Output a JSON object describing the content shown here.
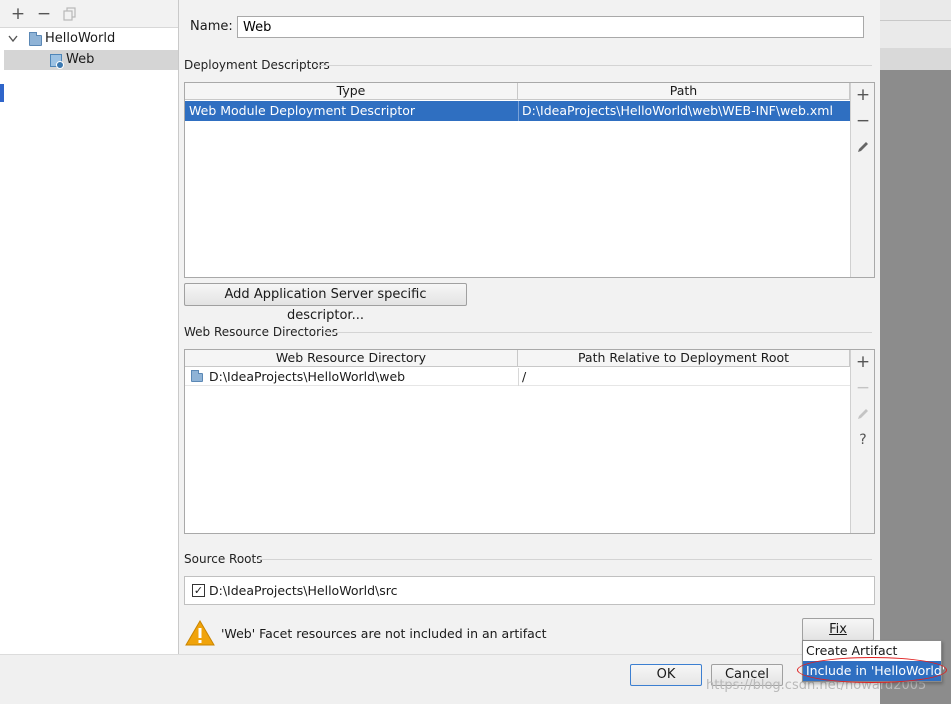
{
  "tree": {
    "items": [
      {
        "label": "HelloWorld",
        "expanded": true
      },
      {
        "label": "Web",
        "selected": true
      }
    ]
  },
  "name": {
    "label": "Name:",
    "value": "Web"
  },
  "deployment": {
    "title": "Deployment Descriptors",
    "columns": [
      "Type",
      "Path"
    ],
    "rows": [
      {
        "type": "Web Module Deployment Descriptor",
        "path": "D:\\IdeaProjects\\HelloWorld\\web\\WEB-INF\\web.xml"
      }
    ],
    "add_server_button": "Add Application Server specific descriptor..."
  },
  "web_resources": {
    "title": "Web Resource Directories",
    "columns": [
      "Web Resource Directory",
      "Path Relative to Deployment Root"
    ],
    "rows": [
      {
        "directory": "D:\\IdeaProjects\\HelloWorld\\web",
        "relative": "/"
      }
    ],
    "help_glyph": "?"
  },
  "source_roots": {
    "title": "Source Roots",
    "items": [
      {
        "path": "D:\\IdeaProjects\\HelloWorld\\src",
        "checked": true
      }
    ]
  },
  "warning": {
    "text": "'Web' Facet resources are not included in an artifact"
  },
  "fix_button": "Fix",
  "fix_popup": {
    "items": [
      "Create Artifact",
      "Include in 'HelloWorld'"
    ]
  },
  "dialog": {
    "ok": "OK",
    "cancel": "Cancel"
  },
  "watermark": "https://blog.csdn.net/howard2005",
  "colors": {
    "selection": "#2f6fc1",
    "warning": "#f0a30a",
    "highlight_ring": "#e02020"
  }
}
